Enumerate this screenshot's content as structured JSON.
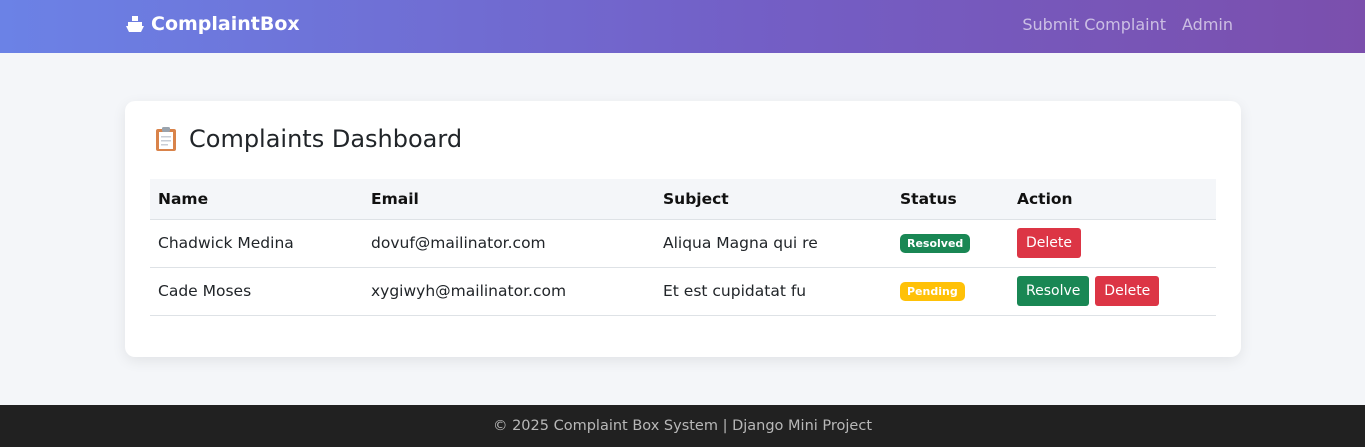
{
  "navbar": {
    "brand": "ComplaintBox",
    "brand_icon": "ship-icon",
    "links": [
      {
        "label": "Submit Complaint"
      },
      {
        "label": "Admin"
      }
    ]
  },
  "dashboard": {
    "title_icon": "clipboard-icon",
    "title": "Complaints Dashboard",
    "columns": [
      "Name",
      "Email",
      "Subject",
      "Status",
      "Action"
    ],
    "rows": [
      {
        "name": "Chadwick Medina",
        "email": "dovuf@mailinator.com",
        "subject": "Aliqua Magna qui re",
        "status": "Resolved",
        "actions": [
          "Delete"
        ]
      },
      {
        "name": "Cade Moses",
        "email": "xygiwyh@mailinator.com",
        "subject": "Et est cupidatat fu",
        "status": "Pending",
        "actions": [
          "Resolve",
          "Delete"
        ]
      }
    ]
  },
  "colors": {
    "nav_gradient_start": "#6b82e6",
    "nav_gradient_end": "#7b4fad",
    "resolved": "#198754",
    "pending": "#ffc107",
    "danger": "#dc3545",
    "footer_bg": "#212121"
  },
  "footer": {
    "text": "© 2025 Complaint Box System | Django Mini Project"
  }
}
